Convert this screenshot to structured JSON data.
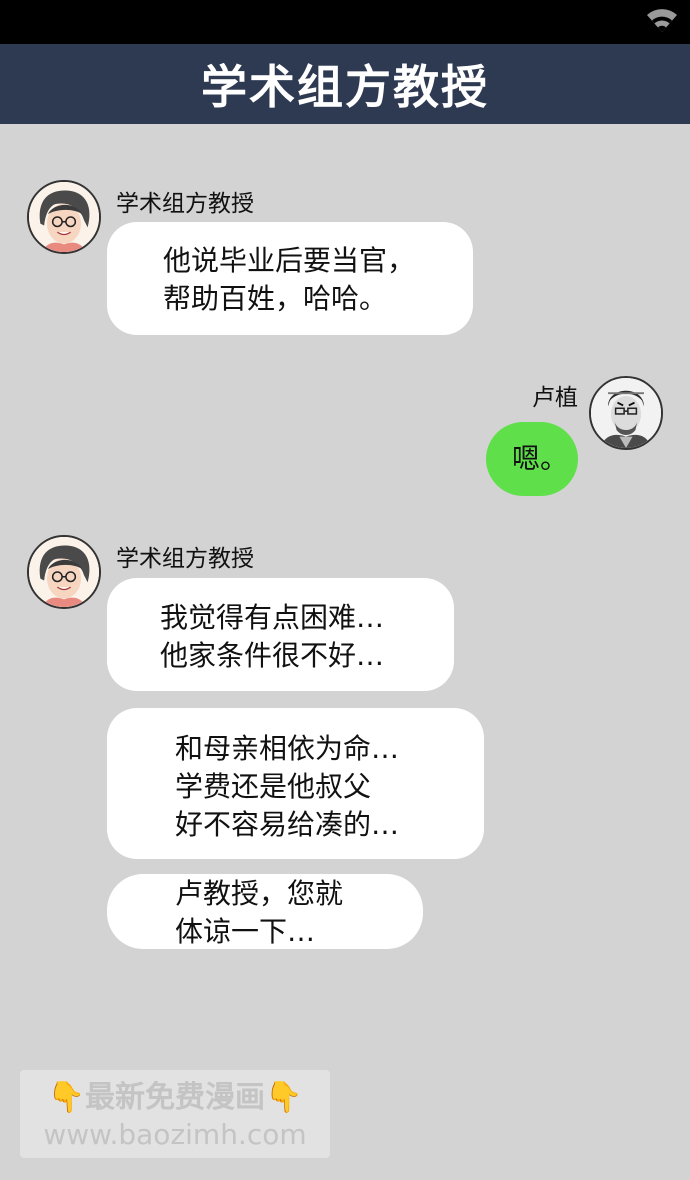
{
  "header": {
    "title": "学术组方教授"
  },
  "messages": [
    {
      "sender": "学术组方教授",
      "side": "left",
      "lines": [
        "他说毕业后要当官，",
        "帮助百姓，哈哈。"
      ]
    },
    {
      "sender": "卢植",
      "side": "right",
      "lines": [
        "嗯。"
      ]
    },
    {
      "sender": "学术组方教授",
      "side": "left",
      "lines": [
        "我觉得有点困难…",
        "他家条件很不好…"
      ]
    },
    {
      "side": "left",
      "lines": [
        "和母亲相依为命…",
        "学费还是他叔父",
        "好不容易给凑的…"
      ]
    },
    {
      "side": "left",
      "lines": [
        "卢教授，您就",
        "体谅一下…"
      ]
    }
  ],
  "watermark": {
    "line1": "最新免费漫画",
    "line2": "www.baozimh.com",
    "hand_glyph": "👇"
  },
  "colors": {
    "title_bar": "#2e3a52",
    "background": "#d3d3d3",
    "green_bubble": "#5fdf4a"
  },
  "icons": {
    "status": "wifi-icon"
  }
}
